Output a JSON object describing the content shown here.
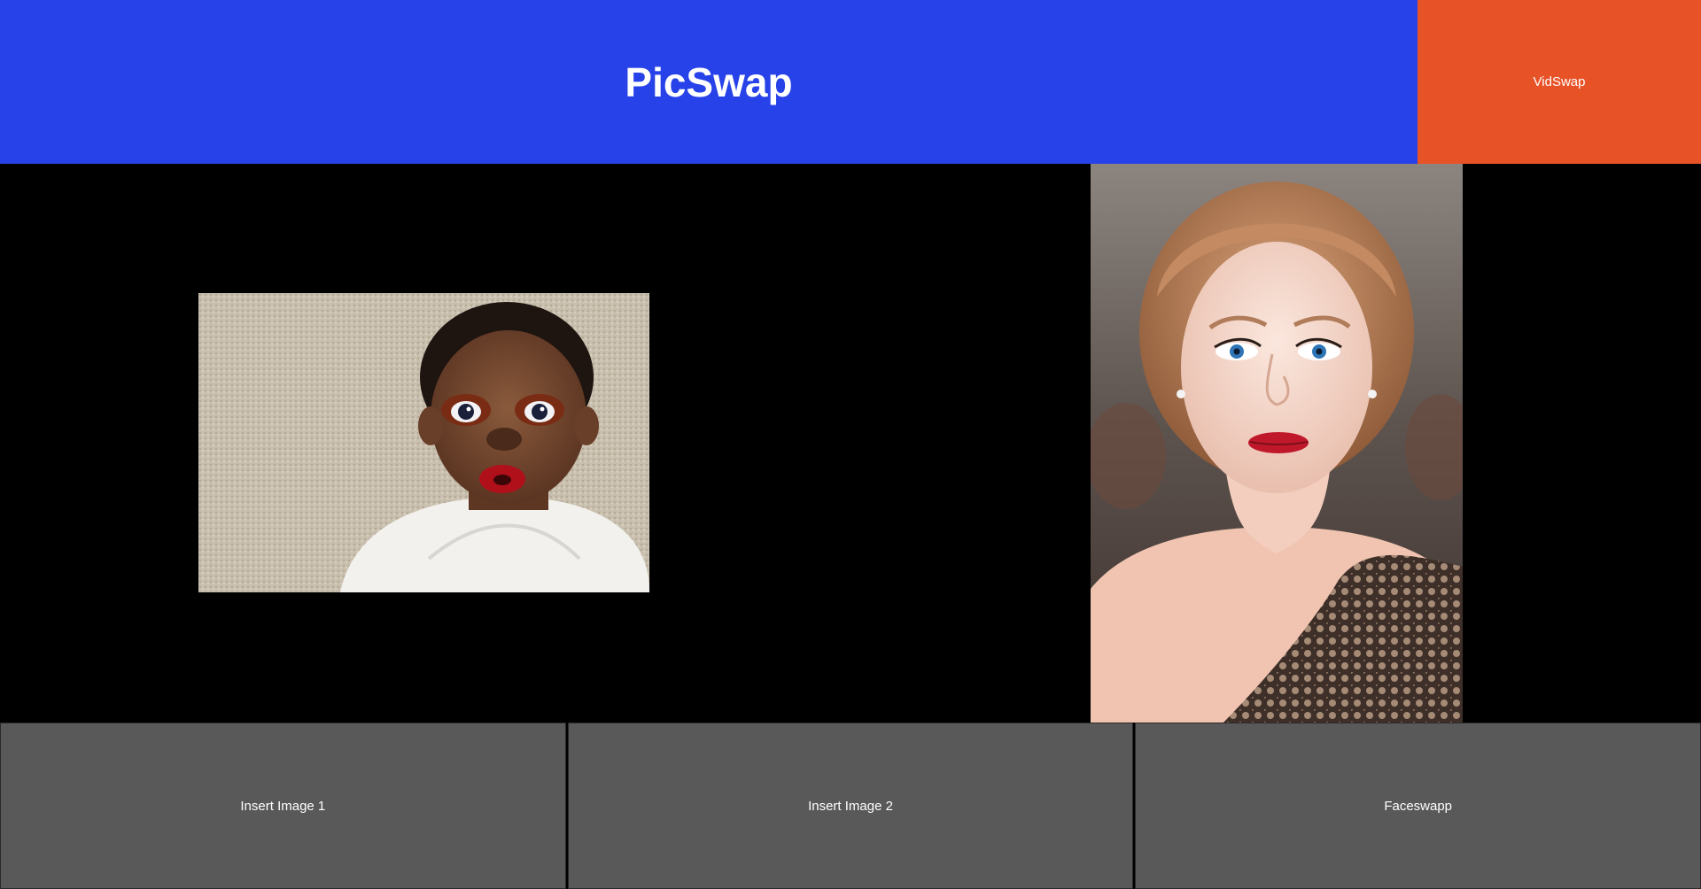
{
  "header": {
    "title": "PicSwap",
    "background_color": "#2742e8"
  },
  "nav": {
    "vidswap_label": "VidSwap",
    "vidswap_color": "#e85227"
  },
  "images": {
    "image1": {
      "description_icon": "photo-icon"
    },
    "image2": {
      "description_icon": "photo-icon"
    }
  },
  "actions": {
    "insert_image_1_label": "Insert Image 1",
    "insert_image_2_label": "Insert Image 2",
    "faceswap_label": "Faceswapp",
    "button_color": "#595959"
  }
}
